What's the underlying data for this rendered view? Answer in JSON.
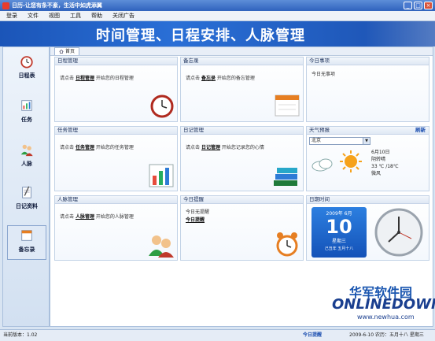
{
  "window": {
    "title": "日历-让您有条不紊，生活中如虎添翼"
  },
  "menu": {
    "items": [
      "登录",
      "文件",
      "视图",
      "工具",
      "帮助",
      "关闭广告"
    ]
  },
  "banner": {
    "title": "时间管理、日程安排、人脉管理"
  },
  "sidebar": {
    "items": [
      {
        "label": "日程表",
        "icon": "alarm-clock-icon"
      },
      {
        "label": "任务",
        "icon": "task-icon"
      },
      {
        "label": "人脉",
        "icon": "people-icon"
      },
      {
        "label": "日记资料",
        "icon": "diary-icon"
      },
      {
        "label": "备忘录",
        "icon": "memo-icon"
      }
    ]
  },
  "tabs": [
    {
      "label": "首页"
    }
  ],
  "panels": {
    "schedule": {
      "title": "日程管理",
      "text_pre": "请点击",
      "link": "日程管理",
      "text_post": "开始您的日程管理"
    },
    "memo": {
      "title": "备忘录",
      "text_pre": "请点击",
      "link": "备忘录",
      "text_post": "开始您的备忘管理"
    },
    "today": {
      "title": "今日事项",
      "text": "今日无事项"
    },
    "task": {
      "title": "任务管理",
      "text_pre": "请点击",
      "link": "任务管理",
      "text_post": "开始您的任务管理"
    },
    "diary": {
      "title": "日记管理",
      "text_pre": "请点击",
      "link": "日记管理",
      "text_post": "开始您记录您的心情"
    },
    "weather": {
      "title": "天气预报",
      "refresh": "刷新",
      "city": "北京",
      "date": "6月10日",
      "condition": "阴转晴",
      "temp": "33 ℃ /18℃",
      "wind": "微风"
    },
    "contacts": {
      "title": "人脉管理",
      "text_pre": "请点击",
      "link": "人脉管理",
      "text_post": "开始您的人脉管理"
    },
    "reminder": {
      "title": "今日提醒",
      "text": "今日无提醒",
      "link": "今日提醒"
    },
    "datetime": {
      "title": "日期时间",
      "year_month": "2009年 6月",
      "day": "10",
      "weekday": "星期三",
      "lunar": "己丑年 五月十八"
    }
  },
  "status": {
    "version": "当前版本：1.02",
    "remind": "今日提醒",
    "date": "2009-6-10 农历：五月十八 星期三"
  },
  "watermark": {
    "cn": "华军软件园",
    "en": "ONLINEDOWN",
    "url": "www.newhua.com"
  }
}
